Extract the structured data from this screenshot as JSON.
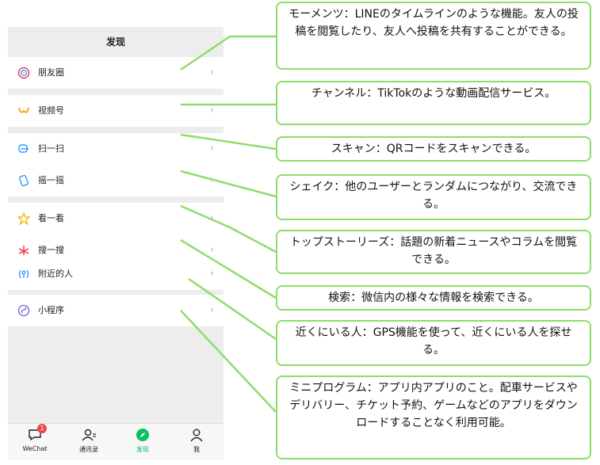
{
  "phone": {
    "header_title": "发现",
    "menu": [
      {
        "label": "朋友圈",
        "icon": "moments-icon"
      },
      {
        "label": "视频号",
        "icon": "channels-icon"
      },
      {
        "label": "扫一扫",
        "icon": "scan-icon"
      },
      {
        "label": "摇一摇",
        "icon": "shake-icon"
      },
      {
        "label": "看一看",
        "icon": "top-stories-icon"
      },
      {
        "label": "搜一搜",
        "icon": "search-icon"
      },
      {
        "label": "附近的人",
        "icon": "people-nearby-icon"
      },
      {
        "label": "小程序",
        "icon": "mini-programs-icon"
      }
    ],
    "chevron": "›",
    "tabs": [
      {
        "label": "WeChat",
        "icon": "chat-bubble-icon",
        "badge": "1"
      },
      {
        "label": "通讯录",
        "icon": "contacts-icon"
      },
      {
        "label": "发现",
        "icon": "compass-icon",
        "active": true
      },
      {
        "label": "我",
        "icon": "profile-icon"
      }
    ],
    "accent_color": "#07c160"
  },
  "callouts": [
    {
      "target": "朋友圈",
      "text": "モーメンツ：LINEのタイムラインのような機能。友人の投稿を閲覧したり、友人へ投稿を共有することができる。"
    },
    {
      "target": "视频号",
      "text": "チャンネル：TikTokのような動画配信サービス。"
    },
    {
      "target": "扫一扫",
      "text": "スキャン：QRコードをスキャンできる。"
    },
    {
      "target": "摇一摇",
      "text": "シェイク：他のユーザーとランダムにつながり、交流できる。"
    },
    {
      "target": "看一看",
      "text": "トップストーリーズ：話題の新着ニュースやコラムを閲覧できる。"
    },
    {
      "target": "搜一搜",
      "text": "検索：微信内の様々な情報を検索できる。"
    },
    {
      "target": "附近的人",
      "text": "近くにいる人：GPS機能を使って、近くにいる人を探せる。"
    },
    {
      "target": "小程序",
      "text": "ミニプログラム：アプリ内アプリのこと。配車サービスやデリバリー、チケット予約、ゲームなどのアプリをダウンロードすることなく利用可能。"
    }
  ],
  "callout_border_color": "#8fdc6b"
}
